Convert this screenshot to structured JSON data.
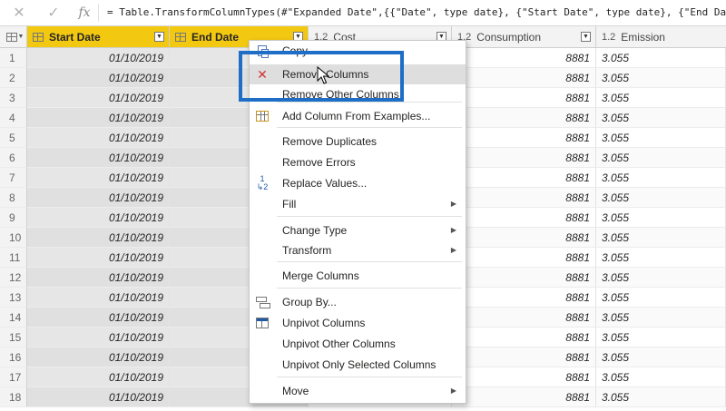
{
  "formula_bar": {
    "cancel_icon": "x-icon",
    "commit_icon": "check-icon",
    "fx_label": "fx",
    "formula": "= Table.TransformColumnTypes(#\"Expanded Date\",{{\"Date\", type date}, {\"Start Date\", type date}, {\"End Date"
  },
  "grid": {
    "columns": [
      {
        "type_label": "",
        "label": "Start Date",
        "selected": true
      },
      {
        "type_label": "",
        "label": "End Date",
        "selected": true
      },
      {
        "type_label": "1.2",
        "label": "Cost",
        "selected": false
      },
      {
        "type_label": "1.2",
        "label": "Consumption",
        "selected": false
      },
      {
        "type_label": "1.2",
        "label": "Emission",
        "selected": false
      }
    ],
    "rows": [
      {
        "n": "1",
        "start": "01/10/2019",
        "consumption": "8881",
        "emission": "3.055"
      },
      {
        "n": "2",
        "start": "01/10/2019",
        "consumption": "8881",
        "emission": "3.055"
      },
      {
        "n": "3",
        "start": "01/10/2019",
        "consumption": "8881",
        "emission": "3.055"
      },
      {
        "n": "4",
        "start": "01/10/2019",
        "consumption": "8881",
        "emission": "3.055"
      },
      {
        "n": "5",
        "start": "01/10/2019",
        "consumption": "8881",
        "emission": "3.055"
      },
      {
        "n": "6",
        "start": "01/10/2019",
        "consumption": "8881",
        "emission": "3.055"
      },
      {
        "n": "7",
        "start": "01/10/2019",
        "consumption": "8881",
        "emission": "3.055"
      },
      {
        "n": "8",
        "start": "01/10/2019",
        "consumption": "8881",
        "emission": "3.055"
      },
      {
        "n": "9",
        "start": "01/10/2019",
        "consumption": "8881",
        "emission": "3.055"
      },
      {
        "n": "10",
        "start": "01/10/2019",
        "consumption": "8881",
        "emission": "3.055"
      },
      {
        "n": "11",
        "start": "01/10/2019",
        "consumption": "8881",
        "emission": "3.055"
      },
      {
        "n": "12",
        "start": "01/10/2019",
        "consumption": "8881",
        "emission": "3.055"
      },
      {
        "n": "13",
        "start": "01/10/2019",
        "consumption": "8881",
        "emission": "3.055"
      },
      {
        "n": "14",
        "start": "01/10/2019",
        "consumption": "8881",
        "emission": "3.055"
      },
      {
        "n": "15",
        "start": "01/10/2019",
        "consumption": "8881",
        "emission": "3.055"
      },
      {
        "n": "16",
        "start": "01/10/2019",
        "consumption": "8881",
        "emission": "3.055"
      },
      {
        "n": "17",
        "start": "01/10/2019",
        "consumption": "8881",
        "emission": "3.055"
      },
      {
        "n": "18",
        "start": "01/10/2019",
        "consumption": "8881",
        "emission": "3.055"
      }
    ]
  },
  "context_menu": {
    "items": [
      {
        "label": "Copy",
        "icon": "copy-icon",
        "submenu": false
      },
      {
        "label": "Remove Columns",
        "icon": "remove-icon",
        "submenu": false,
        "hover": true
      },
      {
        "label": "Remove Other Columns",
        "icon": "",
        "submenu": false
      },
      {
        "label": "Add Column From Examples...",
        "icon": "add-column-examples-icon",
        "submenu": false
      },
      {
        "label": "Remove Duplicates",
        "icon": "",
        "submenu": false
      },
      {
        "label": "Remove Errors",
        "icon": "",
        "submenu": false
      },
      {
        "label": "Replace Values...",
        "icon": "replace-values-icon",
        "submenu": false
      },
      {
        "label": "Fill",
        "icon": "",
        "submenu": true
      },
      {
        "label": "Change Type",
        "icon": "",
        "submenu": true
      },
      {
        "label": "Transform",
        "icon": "",
        "submenu": true
      },
      {
        "label": "Merge Columns",
        "icon": "",
        "submenu": false
      },
      {
        "label": "Group By...",
        "icon": "group-by-icon",
        "submenu": false
      },
      {
        "label": "Unpivot Columns",
        "icon": "unpivot-icon",
        "submenu": false
      },
      {
        "label": "Unpivot Other Columns",
        "icon": "",
        "submenu": false
      },
      {
        "label": "Unpivot Only Selected Columns",
        "icon": "",
        "submenu": false
      },
      {
        "label": "Move",
        "icon": "",
        "submenu": true
      }
    ]
  },
  "colors": {
    "selected_header": "#f2c811",
    "highlight_box": "#1e6ec8",
    "remove_icon": "#d13438"
  }
}
